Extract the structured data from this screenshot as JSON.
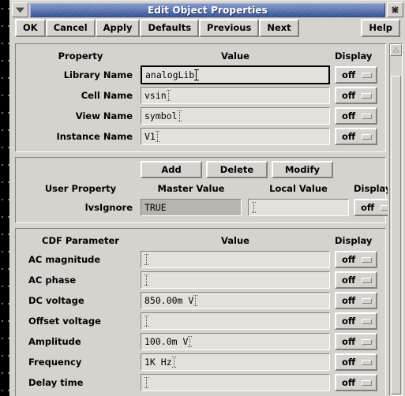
{
  "window": {
    "title": "Edit Object Properties",
    "menu_icon": "chevron-down-icon",
    "close_icon": "close-icon"
  },
  "actionbar": {
    "buttons": [
      {
        "label": "OK",
        "name": "ok-button"
      },
      {
        "label": "Cancel",
        "name": "cancel-button"
      },
      {
        "label": "Apply",
        "name": "apply-button"
      },
      {
        "label": "Defaults",
        "name": "defaults-button"
      },
      {
        "label": "Previous",
        "name": "previous-button"
      },
      {
        "label": "Next",
        "name": "next-button"
      }
    ],
    "help": "Help"
  },
  "sections": {
    "property": {
      "headers": {
        "name": "Property",
        "value": "Value",
        "display": "Display"
      },
      "rows": [
        {
          "label": "Library Name",
          "value": "analogLib",
          "display": "off",
          "focused": true
        },
        {
          "label": "Cell Name",
          "value": "vsin",
          "display": "off",
          "focused": false
        },
        {
          "label": "View Name",
          "value": "symbol",
          "display": "off",
          "focused": false
        },
        {
          "label": "Instance Name",
          "value": "V1",
          "display": "off",
          "focused": false
        }
      ]
    },
    "user_property": {
      "buttons": [
        {
          "label": "Add",
          "name": "add-button"
        },
        {
          "label": "Delete",
          "name": "delete-button"
        },
        {
          "label": "Modify",
          "name": "modify-button"
        }
      ],
      "headers": {
        "name": "User Property",
        "master": "Master Value",
        "local": "Local Value",
        "display": "Display"
      },
      "rows": [
        {
          "label": "lvsIgnore",
          "master_value": "TRUE",
          "local_value": "",
          "display": "off"
        }
      ]
    },
    "cdf": {
      "headers": {
        "name": "CDF Parameter",
        "value": "Value",
        "display": "Display"
      },
      "rows": [
        {
          "label": "AC magnitude",
          "value": "",
          "display": "off"
        },
        {
          "label": "AC phase",
          "value": "",
          "display": "off"
        },
        {
          "label": "DC voltage",
          "value": "850.00m V",
          "display": "off"
        },
        {
          "label": "Offset voltage",
          "value": "",
          "display": "off"
        },
        {
          "label": "Amplitude",
          "value": "100.0m V",
          "display": "off"
        },
        {
          "label": "Frequency",
          "value": "1K Hz",
          "display": "off"
        },
        {
          "label": "Delay time",
          "value": "",
          "display": "off"
        }
      ]
    }
  },
  "scrollbar": {
    "up_arrow_icon": "triangle-up-icon"
  }
}
